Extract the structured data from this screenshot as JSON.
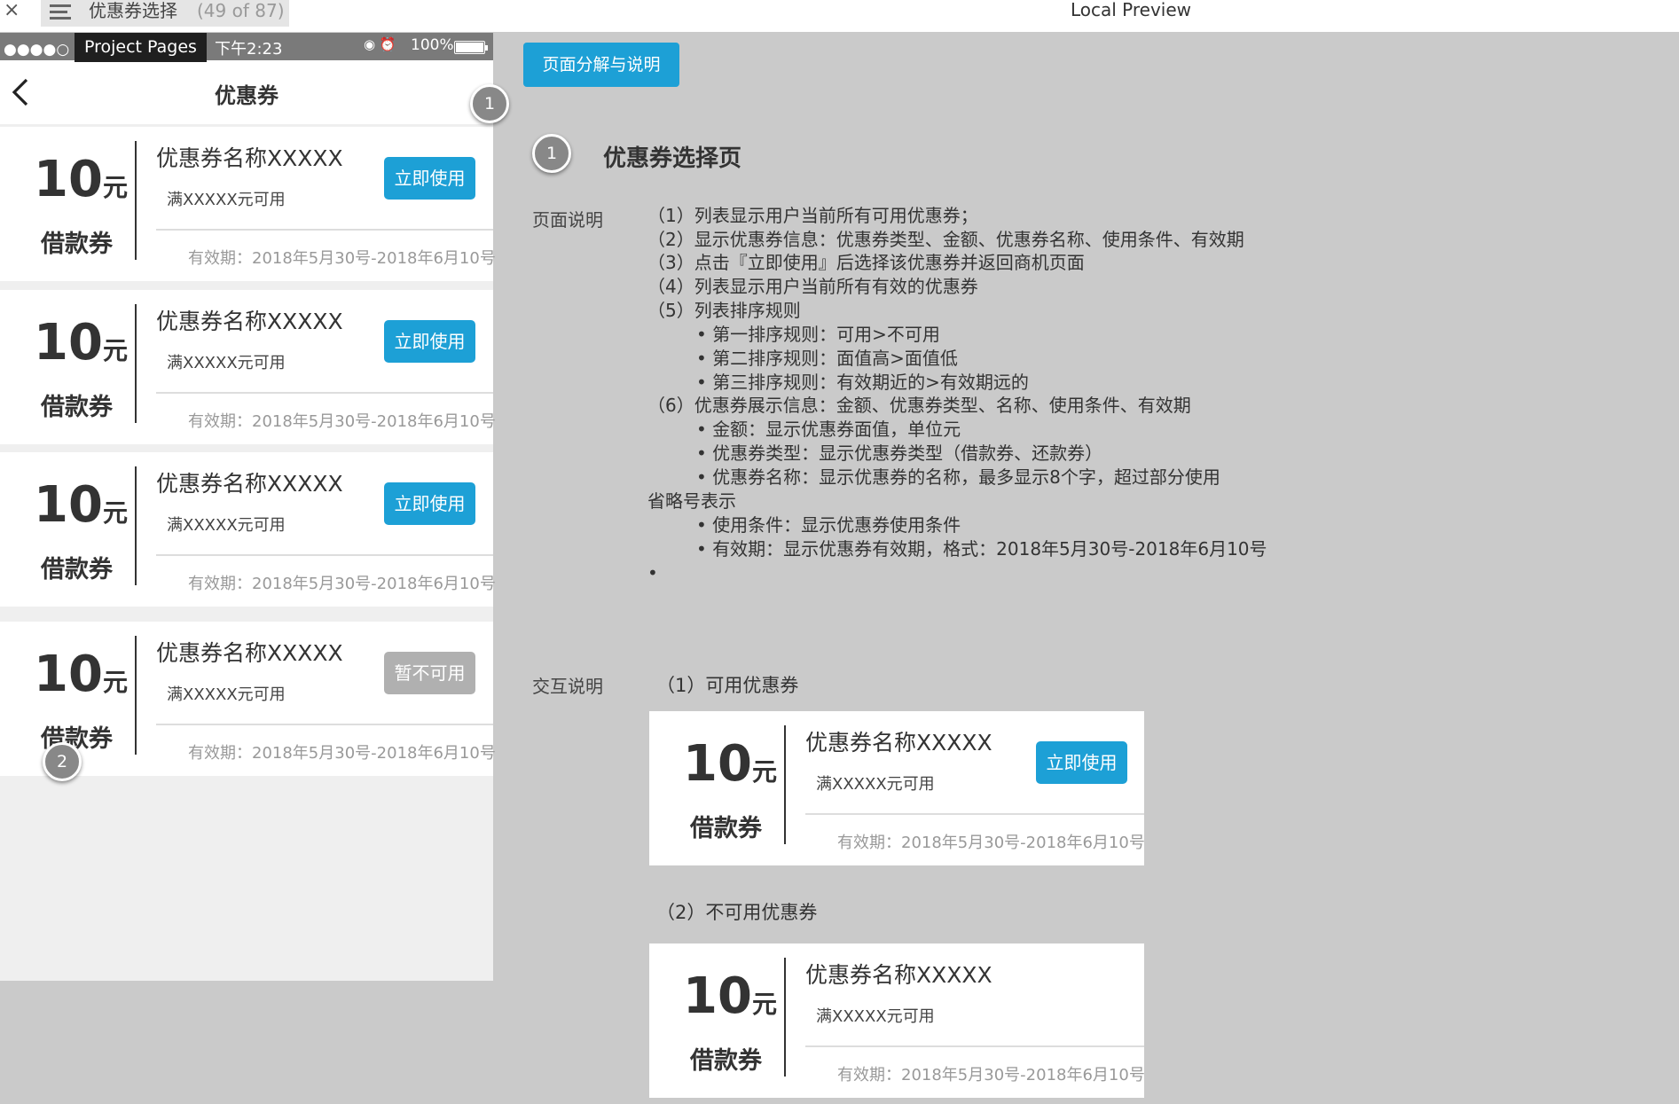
{
  "topbar": {
    "close_label": "×",
    "page_title": "优惠券选择",
    "page_count": "(49 of 87)",
    "app_title": "Local Preview"
  },
  "phone": {
    "status": {
      "signal": "●●●●○ 中",
      "tooltip": "Project Pages",
      "time": "下午2:23",
      "icons": "◉ ⏰",
      "battery_pct": "100%",
      "battery_level": 1.0
    },
    "nav_title": "优惠券",
    "coupons": [
      {
        "amount": "10",
        "unit": "元",
        "type": "借款券",
        "name": "优惠券名称XXXXX",
        "condition": "满XXXXX元可用",
        "validity": "有效期：2018年5月30号-2018年6月10号",
        "button": "立即使用",
        "enabled": true
      },
      {
        "amount": "10",
        "unit": "元",
        "type": "借款券",
        "name": "优惠券名称XXXXX",
        "condition": "满XXXXX元可用",
        "validity": "有效期：2018年5月30号-2018年6月10号",
        "button": "立即使用",
        "enabled": true
      },
      {
        "amount": "10",
        "unit": "元",
        "type": "借款券",
        "name": "优惠券名称XXXXX",
        "condition": "满XXXXX元可用",
        "validity": "有效期：2018年5月30号-2018年6月10号",
        "button": "立即使用",
        "enabled": true
      },
      {
        "amount": "10",
        "unit": "元",
        "type": "借款券",
        "name": "优惠券名称XXXXX",
        "condition": "满XXXXX元可用",
        "validity": "有效期：2018年5月30号-2018年6月10号",
        "button": "暂不可用",
        "enabled": false
      }
    ],
    "badges": [
      "1",
      "2"
    ]
  },
  "panel": {
    "decomp_button": "页面分解与说明",
    "section_badge": "1",
    "section_title": "优惠券选择页",
    "page_desc_label": "页面说明",
    "page_desc": [
      "（1）列表显示用户当前所有可用优惠券；",
      "（2）显示优惠券信息：优惠券类型、金额、优惠券名称、使用条件、有效期",
      "（3）点击『立即使用』后选择该优惠券并返回商机页面",
      "（4）列表显示用户当前所有有效的优惠券",
      "（5）列表排序规则",
      "• 第一排序规则：可用>不可用",
      "• 第二排序规则：面值高>面值低",
      "• 第三排序规则：有效期近的>有效期远的",
      "（6）优惠券展示信息：金额、优惠券类型、名称、使用条件、有效期",
      "• 金额：显示优惠券面值，单位元",
      "• 优惠券类型：显示优惠券类型（借款券、还款券）",
      "• 优惠券名称：显示优惠券的名称，最多显示8个字，超过部分使用",
      "省略号表示",
      "• 使用条件：显示优惠券使用条件",
      "• 有效期：显示优惠券有效期，格式：2018年5月30号-2018年6月10号",
      "•"
    ],
    "interaction_label": "交互说明",
    "available_title": "（1）可用优惠券",
    "unavailable_title": "（2）不可用优惠券",
    "sample_available": {
      "amount": "10",
      "unit": "元",
      "type": "借款券",
      "name": "优惠券名称XXXXX",
      "condition": "满XXXXX元可用",
      "validity": "有效期：2018年5月30号-2018年6月10号",
      "button": "立即使用"
    },
    "sample_unavailable": {
      "amount": "10",
      "unit": "元",
      "type": "借款券",
      "name": "优惠券名称XXXXX",
      "condition": "满XXXXX元可用",
      "validity": "有效期：2018年5月30号-2018年6月10号"
    }
  },
  "colors": {
    "accent": "#1da0d6",
    "disabled": "#b0b0b0",
    "canvas": "#cacaca"
  }
}
